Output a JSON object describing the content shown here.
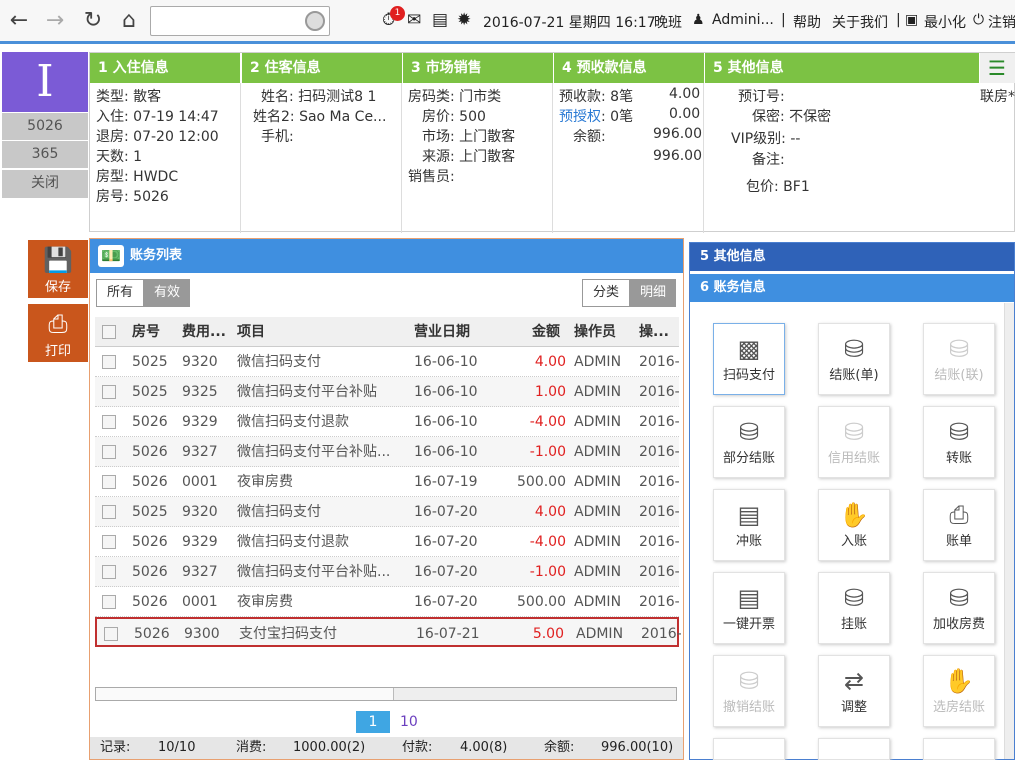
{
  "topbar": {
    "notif_count": "1",
    "datetime": "2016-07-21 星期四 16:17",
    "shift": "晚班",
    "user": "Admini...",
    "help": "帮助",
    "about": "关于我们",
    "minimize": "最小化",
    "logout": "注销"
  },
  "left": {
    "room_letter": "I",
    "room": "5026",
    "code": "365",
    "close": "关闭"
  },
  "info": {
    "tabs": [
      "1  入住信息",
      "2  住客信息",
      "3  市场销售",
      "4  预收款信息",
      "5  其他信息"
    ],
    "checkin": {
      "type": "类型: 散客",
      "in": "入住: 07-19 14:47",
      "out": "退房: 07-20 12:00",
      "days": "天数: 1",
      "roomtype": "房型: HWDC",
      "roomno": "房号: 5026"
    },
    "guest": {
      "name": "姓名: 扫码测试8   1",
      "name2": "姓名2: Sao Ma Ce...",
      "phone": "手机:"
    },
    "market": {
      "cls": "房码类: 门市类",
      "price": "房价: 500",
      "market": "市场: 上门散客",
      "source": "来源: 上门散客",
      "sales": "销售员:"
    },
    "deposit": {
      "prepay_label": "预收款: 8笔",
      "prepay_amt": "4.00",
      "auth_label": "预授权",
      "auth_val": ": 0笔",
      "auth_amt": "0.00",
      "bal_label": "余额:",
      "bal_amt": "996.00",
      "total": "996.00"
    },
    "other": {
      "order": "预订号:",
      "secret": "保密: 不保密",
      "vip": "VIP级别: --",
      "remark": "备注:",
      "pkg": "包价: BF1",
      "room_link": "联房*"
    }
  },
  "side": {
    "save": "保存",
    "print": "打印"
  },
  "acct": {
    "title": "账务列表",
    "filter_all": "所有",
    "filter_valid": "有效",
    "view_class": "分类",
    "view_detail": "明细",
    "headers": [
      "房号",
      "费用...",
      "项目",
      "营业日期",
      "金额",
      "操作员",
      "操..."
    ],
    "rows": [
      {
        "room": "5025",
        "code": "9320",
        "item": "微信扫码支付",
        "date": "16-06-10",
        "amt": "4.00",
        "op": "ADMIN",
        "t": "2016-"
      },
      {
        "room": "5025",
        "code": "9325",
        "item": "微信扫码支付平台补贴",
        "date": "16-06-10",
        "amt": "1.00",
        "op": "ADMIN",
        "t": "2016-"
      },
      {
        "room": "5026",
        "code": "9329",
        "item": "微信扫码支付退款",
        "date": "16-06-10",
        "amt": "-4.00",
        "op": "ADMIN",
        "t": "2016-"
      },
      {
        "room": "5026",
        "code": "9327",
        "item": "微信扫码支付平台补贴...",
        "date": "16-06-10",
        "amt": "-1.00",
        "op": "ADMIN",
        "t": "2016-"
      },
      {
        "room": "5026",
        "code": "0001",
        "item": "夜审房费",
        "date": "16-07-19",
        "amt": "500.00",
        "op": "ADMIN",
        "t": "2016-"
      },
      {
        "room": "5025",
        "code": "9320",
        "item": "微信扫码支付",
        "date": "16-07-20",
        "amt": "4.00",
        "op": "ADMIN",
        "t": "2016-"
      },
      {
        "room": "5026",
        "code": "9329",
        "item": "微信扫码支付退款",
        "date": "16-07-20",
        "amt": "-4.00",
        "op": "ADMIN",
        "t": "2016-"
      },
      {
        "room": "5026",
        "code": "9327",
        "item": "微信扫码支付平台补贴...",
        "date": "16-07-20",
        "amt": "-1.00",
        "op": "ADMIN",
        "t": "2016-"
      },
      {
        "room": "5026",
        "code": "0001",
        "item": "夜审房费",
        "date": "16-07-20",
        "amt": "500.00",
        "op": "ADMIN",
        "t": "2016-"
      },
      {
        "room": "5026",
        "code": "9300",
        "item": "支付宝扫码支付",
        "date": "16-07-21",
        "amt": "5.00",
        "op": "ADMIN",
        "t": "2016-"
      }
    ],
    "page_current": "1",
    "page_total": "10",
    "status": {
      "rec_label": "记录:",
      "rec": "10/10",
      "cons_label": "消费:",
      "cons": "1000.00(2)",
      "pay_label": "付款:",
      "pay": "4.00(8)",
      "bal_label": "余额:",
      "bal": "996.00(10)"
    }
  },
  "rpanel": {
    "head5": "5  其他信息",
    "head6": "6  账务信息",
    "actions": [
      "扫码支付",
      "结账(单)",
      "结账(联)",
      "部分结账",
      "信用结账",
      "转账",
      "冲账",
      "入账",
      "账单",
      "一键开票",
      "挂账",
      "加收房费",
      "撤销结账",
      "调整",
      "选房结账"
    ]
  },
  "colors": {
    "green": "#7cc244",
    "blue": "#3f8fe0",
    "orange": "#c9561c",
    "purple": "#7b5bd6"
  }
}
